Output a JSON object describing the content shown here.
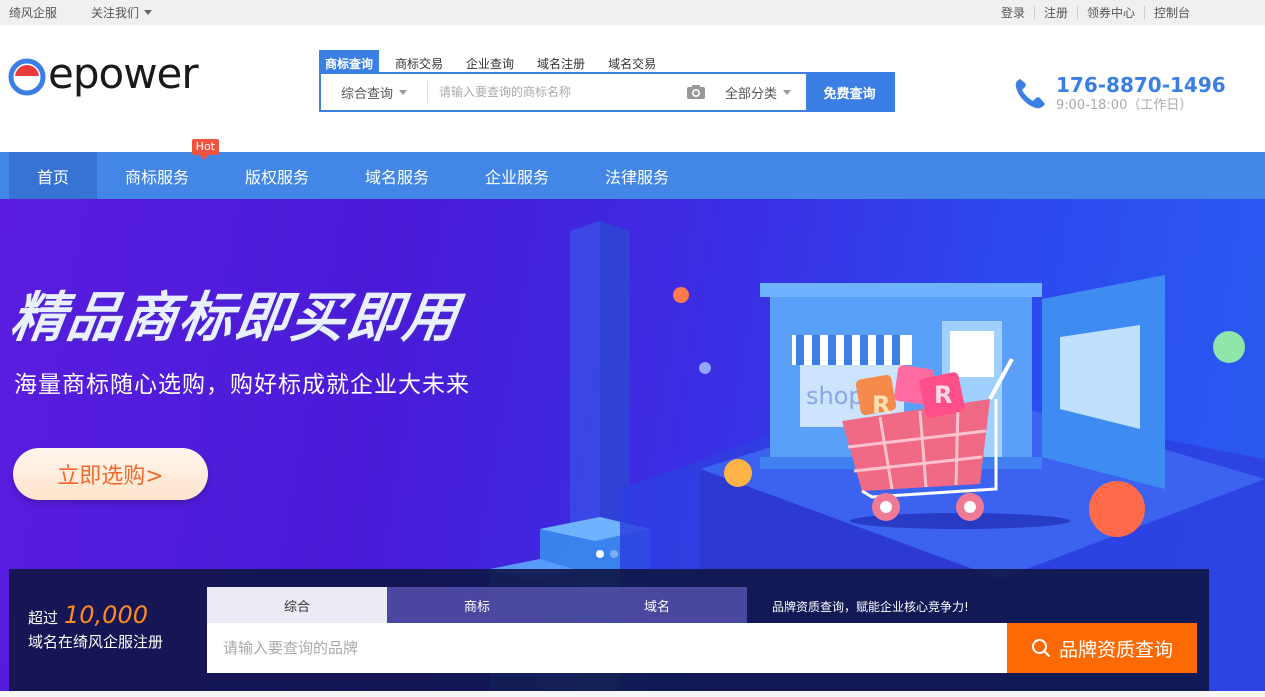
{
  "topbar": {
    "brand": "绮风企服",
    "follow": "关注我们",
    "links": [
      "登录",
      "注册",
      "领券中心",
      "控制台"
    ]
  },
  "logo": {
    "text": "epower"
  },
  "search": {
    "tabs": [
      "商标查询",
      "商标交易",
      "企业查询",
      "域名注册",
      "域名交易"
    ],
    "active_tab": 0,
    "type_select": "综合查询",
    "placeholder": "请输入要查询的商标名称",
    "category_select": "全部分类",
    "button": "免费查询"
  },
  "contact": {
    "phone": "176-8870-1496",
    "hours": "9:00-18:00（工作日）"
  },
  "nav": {
    "items": [
      "首页",
      "商标服务",
      "版权服务",
      "域名服务",
      "企业服务",
      "法律服务"
    ],
    "active": 0,
    "hot_badge": "Hot"
  },
  "banner": {
    "title": "精品商标即买即用",
    "subtitle": "海量商标随心选购，购好标成就企业大未来",
    "cta": "立即选购>",
    "shop_sign": "shop",
    "tag_letter": "R",
    "slides": 2,
    "current_slide": 0
  },
  "panel": {
    "prefix": "超过",
    "count": "10,000",
    "caption": "域名在绮风企服注册",
    "tabs": [
      "综合",
      "商标",
      "域名"
    ],
    "active_tab": 0,
    "slogan": "品牌资质查询，赋能企业核心竞争力!",
    "placeholder": "请输入要查询的品牌",
    "button": "品牌资质查询"
  },
  "colors": {
    "primary": "#3b7fe4",
    "nav": "#4286e6",
    "accent_orange": "#fd6a04",
    "hot_red": "#f0543f"
  }
}
